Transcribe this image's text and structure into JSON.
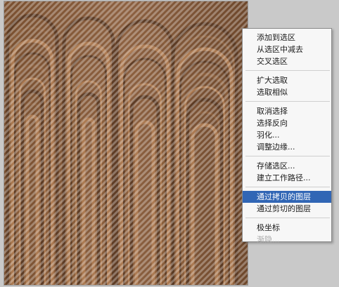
{
  "context_menu": {
    "groups": [
      [
        {
          "label": "添加到选区",
          "state": "normal"
        },
        {
          "label": "从选区中减去",
          "state": "normal"
        },
        {
          "label": "交叉选区",
          "state": "normal"
        }
      ],
      [
        {
          "label": "扩大选取",
          "state": "normal"
        },
        {
          "label": "选取相似",
          "state": "normal"
        }
      ],
      [
        {
          "label": "取消选择",
          "state": "normal"
        },
        {
          "label": "选择反向",
          "state": "normal"
        },
        {
          "label": "羽化...",
          "state": "normal"
        },
        {
          "label": "调整边缘...",
          "state": "normal"
        }
      ],
      [
        {
          "label": "存储选区...",
          "state": "normal"
        },
        {
          "label": "建立工作路径...",
          "state": "normal"
        }
      ],
      [
        {
          "label": "通过拷贝的图层",
          "state": "highlighted"
        },
        {
          "label": "通过剪切的图层",
          "state": "normal"
        }
      ],
      [
        {
          "label": "极坐标",
          "state": "normal"
        },
        {
          "label": "渐隐...",
          "state": "disabled"
        }
      ]
    ]
  },
  "colors": {
    "wood_dark": "#5a3a24",
    "wood_mid": "#8b5e3c",
    "wood_light": "#b07e55",
    "highlight": "#3166b5"
  }
}
